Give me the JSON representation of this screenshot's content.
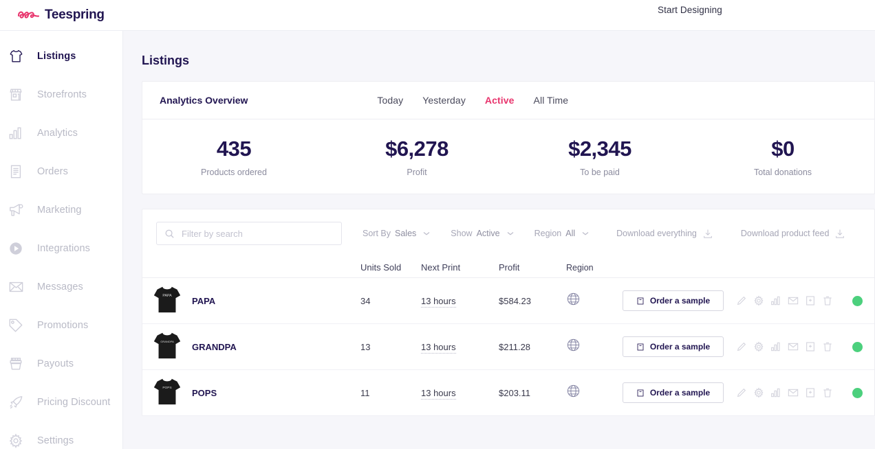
{
  "brand": {
    "name": "Teespring",
    "logo_color": "#e8356d",
    "text_color": "#211551"
  },
  "topbar": {
    "start_designing": "Start Designing"
  },
  "sidebar": {
    "items": [
      {
        "label": "Listings",
        "icon": "tshirt-icon",
        "active": true
      },
      {
        "label": "Storefronts",
        "icon": "storefront-icon",
        "active": false
      },
      {
        "label": "Analytics",
        "icon": "bar-chart-icon",
        "active": false
      },
      {
        "label": "Orders",
        "icon": "document-icon",
        "active": false
      },
      {
        "label": "Marketing",
        "icon": "megaphone-icon",
        "active": false
      },
      {
        "label": "Integrations",
        "icon": "play-circle-icon",
        "active": false
      },
      {
        "label": "Messages",
        "icon": "envelope-icon",
        "active": false
      },
      {
        "label": "Promotions",
        "icon": "tag-icon",
        "active": false
      },
      {
        "label": "Payouts",
        "icon": "money-stack-icon",
        "active": false
      },
      {
        "label": "Pricing Discount",
        "icon": "rocket-icon",
        "active": false
      },
      {
        "label": "Settings",
        "icon": "gear-icon",
        "active": false
      }
    ]
  },
  "page": {
    "title": "Listings"
  },
  "analytics": {
    "title": "Analytics Overview",
    "tabs": [
      {
        "label": "Today",
        "active": false
      },
      {
        "label": "Yesterday",
        "active": false
      },
      {
        "label": "Active",
        "active": true
      },
      {
        "label": "All Time",
        "active": false
      }
    ],
    "active_color": "#e8356d",
    "stats": [
      {
        "value": "435",
        "label": "Products ordered"
      },
      {
        "value": "$6,278",
        "label": "Profit"
      },
      {
        "value": "$2,345",
        "label": "To be paid"
      },
      {
        "value": "$0",
        "label": "Total donations"
      }
    ]
  },
  "toolbar": {
    "search_placeholder": "Filter by search",
    "search_value": "",
    "sort_by_label": "Sort By",
    "sort_by_value": "Sales",
    "show_label": "Show",
    "show_value": "Active",
    "region_label": "Region",
    "region_value": "All",
    "download_everything": "Download everything",
    "download_product_feed": "Download product feed"
  },
  "table": {
    "columns": [
      "",
      "",
      "Units Sold",
      "Next Print",
      "Profit",
      "Region",
      "",
      ""
    ],
    "headers": {
      "units_sold": "Units Sold",
      "next_print": "Next Print",
      "profit": "Profit",
      "region": "Region"
    },
    "action_button_label": "Order a sample",
    "row_icons": [
      "pencil-icon",
      "gear-icon",
      "bar-chart-icon",
      "envelope-icon",
      "duplicate-icon",
      "trash-icon"
    ],
    "status_color": "#4cd07d",
    "rows": [
      {
        "thumb_text": "PAPA",
        "name": "PAPA",
        "units_sold": "34",
        "next_print": "13 hours",
        "profit": "$584.23",
        "region": "globe-icon",
        "status": "active"
      },
      {
        "thumb_text": "GRANDPA",
        "name": "GRANDPA",
        "units_sold": "13",
        "next_print": "13 hours",
        "profit": "$211.28",
        "region": "globe-icon",
        "status": "active"
      },
      {
        "thumb_text": "POPS",
        "name": "POPS",
        "units_sold": "11",
        "next_print": "13 hours",
        "profit": "$203.11",
        "region": "globe-icon",
        "status": "active"
      }
    ]
  }
}
